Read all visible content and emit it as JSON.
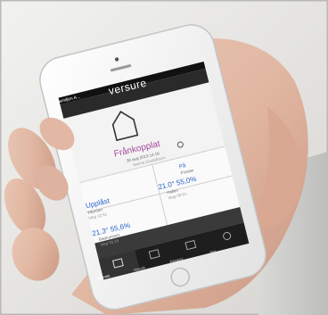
{
  "status_bar": {
    "carrier": "Ingen service",
    "time": "13:39"
  },
  "app_bar": {
    "back_label": "Familjen A...",
    "logo_text": "versure"
  },
  "home": {
    "status_title": "Frånkopplat",
    "status_date": "30 aug 2013 14:19",
    "status_user": "Sanna Gustafsson"
  },
  "lights": {
    "state": "På",
    "label": "Fönster"
  },
  "tiles": {
    "locked": {
      "value": "Upplåst",
      "label": "Ytterdörr",
      "date": "Idag 12:51"
    },
    "hall": {
      "value": "21.0° 55,0%",
      "label": "Hallen",
      "date": "Idag 06:51"
    },
    "bath": {
      "value": "21.3° 55,6%",
      "label": "Badrummet",
      "date": "Idag 06:24"
    }
  },
  "tabbar": {
    "items": [
      {
        "label": "Översikt"
      },
      {
        "label": "Historik"
      },
      {
        "label": "Kameror"
      },
      {
        "label": "Mer"
      }
    ]
  },
  "colors": {
    "accent_purple": "#a64a9a",
    "accent_blue": "#2a63c8",
    "app_bar": "#2a2a2a"
  }
}
